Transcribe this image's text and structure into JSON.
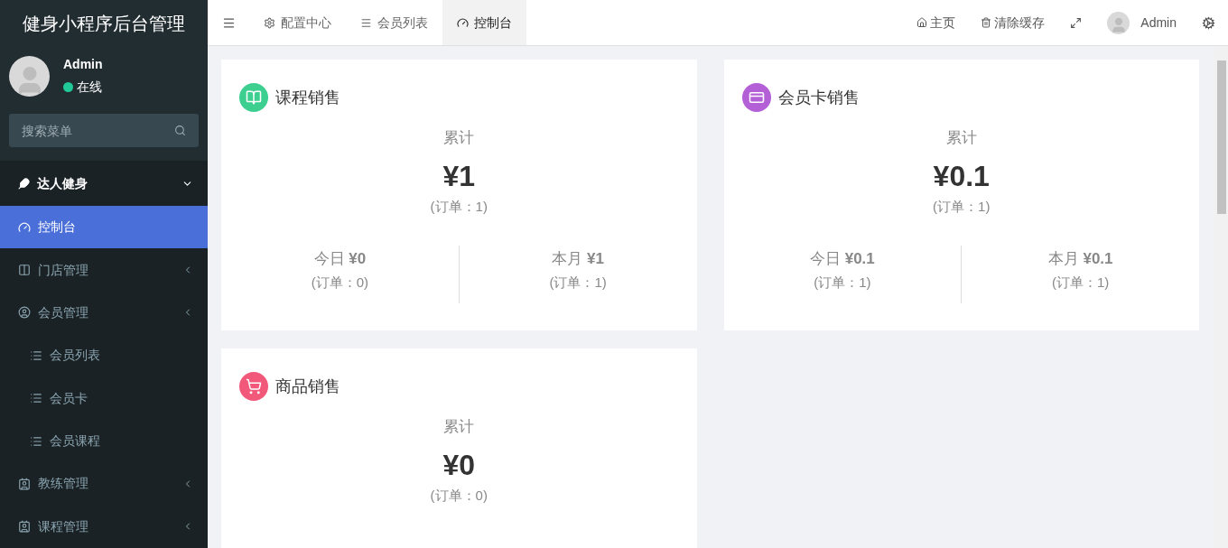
{
  "sidebar": {
    "title": "健身小程序后台管理",
    "user": {
      "name": "Admin",
      "status": "在线",
      "online": true
    },
    "search": {
      "placeholder": "搜索菜单"
    },
    "menu": [
      {
        "label": "达人健身",
        "expanded": true,
        "children": [
          {
            "label": "控制台",
            "selected": true
          },
          {
            "label": "门店管理",
            "selected": false,
            "expanded": false
          },
          {
            "label": "会员管理",
            "selected": false,
            "expanded": false,
            "children": [
              {
                "label": "会员列表",
                "selected": false
              },
              {
                "label": "会员卡",
                "selected": false
              },
              {
                "label": "会员课程",
                "selected": false
              }
            ]
          },
          {
            "label": "教练管理",
            "selected": false,
            "expanded": false
          },
          {
            "label": "课程管理",
            "selected": false,
            "expanded": false
          }
        ]
      }
    ]
  },
  "topbar": {
    "tabs": [
      {
        "label": "配置中心",
        "selected": false
      },
      {
        "label": "会员列表",
        "selected": false
      },
      {
        "label": "控制台",
        "selected": true
      }
    ],
    "actions": [
      "主页",
      "清除缓存"
    ],
    "user": "Admin"
  },
  "cards": [
    {
      "title": "课程销售",
      "color": "#3dcf90",
      "total_label": "累计",
      "total": "¥1",
      "total_orders": "(订单：1)",
      "today": "今日 **¥0**",
      "today_orders": "(订单：0)",
      "month": "本月 **¥1**",
      "month_orders": "(订单：1)"
    },
    {
      "title": "会员卡销售",
      "color": "#b35fd6",
      "total_label": "累计",
      "total": "¥0.1",
      "total_orders": "(订单：1)",
      "today": "今日 **¥0.1**",
      "today_orders": "(订单：1)",
      "month": "本月 **¥0.1**",
      "month_orders": "(订单：1)"
    },
    {
      "title": "商品销售",
      "color": "#f2587a",
      "total_label": "累计",
      "total": "¥0",
      "total_orders": "(订单：0)"
    }
  ]
}
